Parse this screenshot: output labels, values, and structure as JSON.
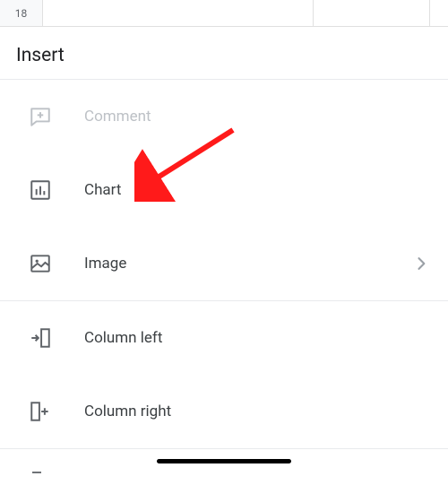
{
  "sheet": {
    "row_number": "18"
  },
  "panel": {
    "title": "Insert"
  },
  "items": {
    "comment": {
      "label": "Comment"
    },
    "chart": {
      "label": "Chart"
    },
    "image": {
      "label": "Image"
    },
    "col_left": {
      "label": "Column left"
    },
    "col_right": {
      "label": "Column right"
    }
  },
  "annotation": {
    "arrow_color": "#ff1a1a"
  }
}
